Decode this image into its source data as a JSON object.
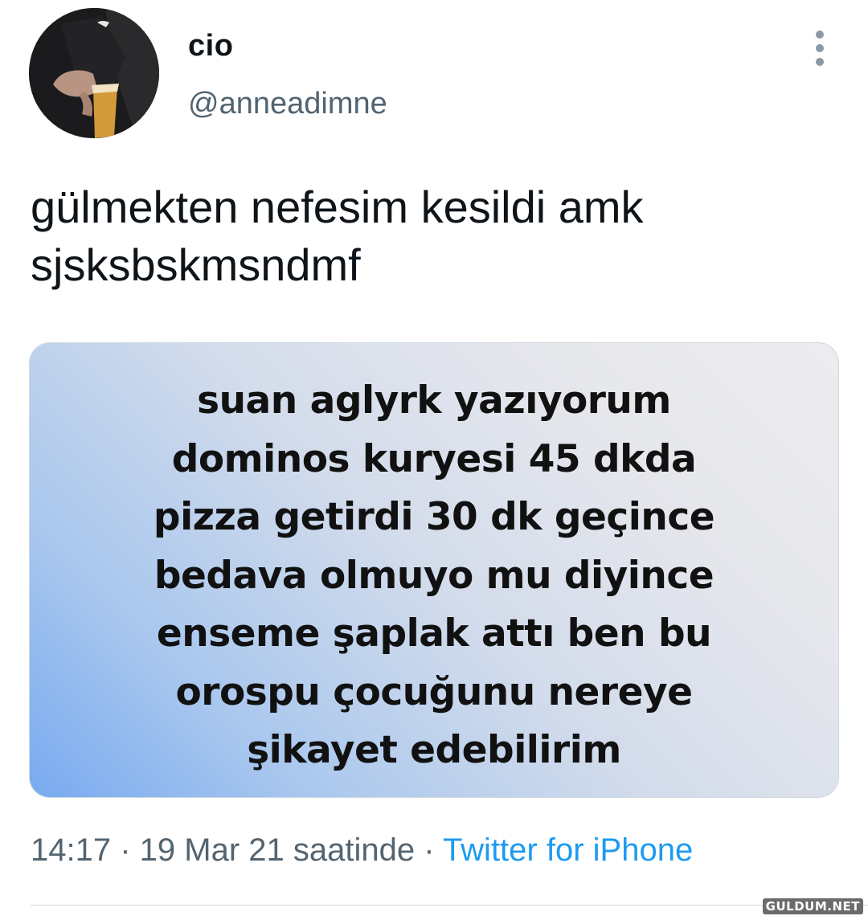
{
  "author": {
    "display_name": "cio",
    "handle": "@anneadimne"
  },
  "tweet": {
    "text_lines": [
      "gülmekten nefesim kesildi amk",
      "sjsksbskmsndmf"
    ],
    "image_text_lines": [
      "suan aglyrk yazıyorum",
      "dominos kuryesi  45 dkda",
      "pizza getirdi 30 dk geçince",
      "bedava olmuyo mu diyince",
      "enseme şaplak attı ben bu",
      "orospu çocuğunu nereye",
      "şikayet edebilirim"
    ]
  },
  "meta": {
    "time": "14:17",
    "separator": " · ",
    "date": "19 Mar 21 saatinde",
    "source": "Twitter for iPhone"
  },
  "watermark": "GULDUM.NET",
  "icons": {
    "more": "more-vertical-icon"
  },
  "colors": {
    "accent": "#1d9bf0",
    "secondary_text": "#536471"
  }
}
